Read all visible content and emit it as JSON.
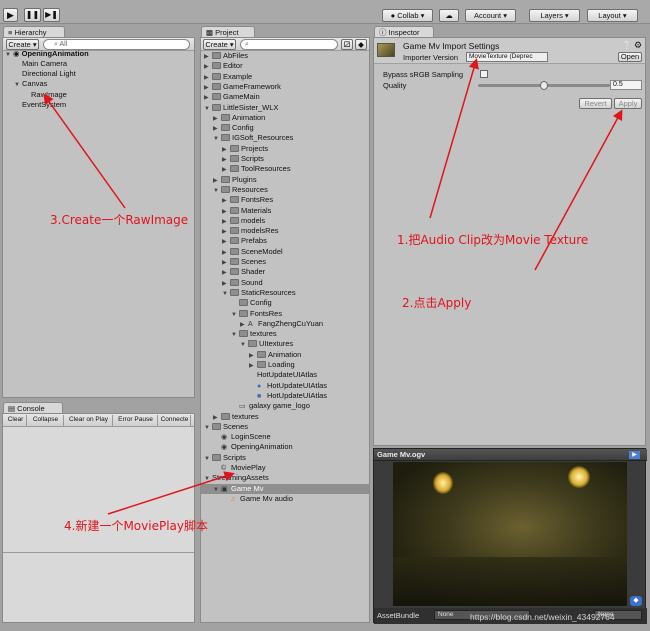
{
  "toolbar": {
    "collab": "Collab",
    "account": "Account",
    "layers": "Layers",
    "layout": "Layout"
  },
  "hierarchy": {
    "tab": "Hierarchy",
    "create": "Create",
    "search_placeholder": "All",
    "scene": "OpeningAnimation",
    "items": [
      "Main Camera",
      "Directional Light",
      "Canvas",
      "RawImage",
      "EventSystem"
    ]
  },
  "project": {
    "tab": "Project",
    "create": "Create",
    "tree": [
      {
        "label": "AbFiles",
        "depth": 0,
        "arrow": "right"
      },
      {
        "label": "Editor",
        "depth": 0,
        "arrow": "right"
      },
      {
        "label": "Example",
        "depth": 0,
        "arrow": "right"
      },
      {
        "label": "GameFramework",
        "depth": 0,
        "arrow": "right"
      },
      {
        "label": "GameMain",
        "depth": 0,
        "arrow": "right"
      },
      {
        "label": "LittleSister_WLX",
        "depth": 0,
        "arrow": "down"
      },
      {
        "label": "Animation",
        "depth": 1,
        "arrow": "right"
      },
      {
        "label": "Config",
        "depth": 1,
        "arrow": "right"
      },
      {
        "label": "IGSoft_Resources",
        "depth": 1,
        "arrow": "down"
      },
      {
        "label": "Projects",
        "depth": 2,
        "arrow": "right"
      },
      {
        "label": "Scripts",
        "depth": 2,
        "arrow": "right"
      },
      {
        "label": "ToolResources",
        "depth": 2,
        "arrow": "right"
      },
      {
        "label": "Plugins",
        "depth": 1,
        "arrow": "right"
      },
      {
        "label": "Resources",
        "depth": 1,
        "arrow": "down"
      },
      {
        "label": "FontsRes",
        "depth": 2,
        "arrow": "right"
      },
      {
        "label": "Materials",
        "depth": 2,
        "arrow": "right"
      },
      {
        "label": "models",
        "depth": 2,
        "arrow": "right"
      },
      {
        "label": "modelsRes",
        "depth": 2,
        "arrow": "right"
      },
      {
        "label": "Prefabs",
        "depth": 2,
        "arrow": "right"
      },
      {
        "label": "SceneModel",
        "depth": 2,
        "arrow": "right"
      },
      {
        "label": "Scenes",
        "depth": 2,
        "arrow": "right"
      },
      {
        "label": "Shader",
        "depth": 2,
        "arrow": "right"
      },
      {
        "label": "Sound",
        "depth": 2,
        "arrow": "right"
      },
      {
        "label": "StaticResources",
        "depth": 2,
        "arrow": "down"
      },
      {
        "label": "Config",
        "depth": 3,
        "arrow": ""
      },
      {
        "label": "FontsRes",
        "depth": 3,
        "arrow": "down"
      },
      {
        "label": "FangZhengCuYuan",
        "depth": 4,
        "arrow": "right",
        "icon": "font"
      },
      {
        "label": "textures",
        "depth": 3,
        "arrow": "down"
      },
      {
        "label": "UItextures",
        "depth": 4,
        "arrow": "down"
      },
      {
        "label": "Animation",
        "depth": 5,
        "arrow": "right"
      },
      {
        "label": "Loading",
        "depth": 5,
        "arrow": "right"
      },
      {
        "label": "HotUpdateUIAtlas",
        "depth": 5,
        "arrow": "",
        "icon": "none"
      },
      {
        "label": "HotUpdateUIAtlas",
        "depth": 5,
        "arrow": "",
        "icon": "sphere"
      },
      {
        "label": "HotUpdateUIAtlas",
        "depth": 5,
        "arrow": "",
        "icon": "cube"
      },
      {
        "label": "galaxy game_logo",
        "depth": 3,
        "arrow": "",
        "icon": "image"
      },
      {
        "label": "textures",
        "depth": 1,
        "arrow": "right"
      },
      {
        "label": "Scenes",
        "depth": 0,
        "arrow": "down"
      },
      {
        "label": "LoginScene",
        "depth": 1,
        "arrow": "",
        "icon": "unity"
      },
      {
        "label": "OpeningAnimation",
        "depth": 1,
        "arrow": "",
        "icon": "unity"
      },
      {
        "label": "Scripts",
        "depth": 0,
        "arrow": "down"
      },
      {
        "label": "MoviePlay",
        "depth": 1,
        "arrow": "",
        "icon": "script"
      },
      {
        "label": "StreamingAssets",
        "depth": 0,
        "arrow": "down",
        "icon": "none"
      },
      {
        "label": "Game Mv",
        "depth": 1,
        "arrow": "down",
        "icon": "movie",
        "selected": true
      },
      {
        "label": "Game Mv audio",
        "depth": 2,
        "arrow": "",
        "icon": "audio"
      }
    ]
  },
  "inspector": {
    "tab": "Inspector",
    "title": "Game Mv Import Settings",
    "open": "Open",
    "importer_label": "Importer Version",
    "importer_value": "MovieTexture (Deprec",
    "bypass_label": "Bypass sRGB Sampling",
    "quality_label": "Quality",
    "quality_value": "0.5",
    "quality_fraction": 0.5,
    "revert": "Revert",
    "apply": "Apply"
  },
  "console": {
    "tab": "Console",
    "buttons": [
      "Clear",
      "Collapse",
      "Clear on Play",
      "Error Pause",
      "Connecte"
    ]
  },
  "preview": {
    "title": "Game Mv.ogv",
    "assetbundle_label": "AssetBundle",
    "assetbundle_value": "None",
    "variant_value": "None",
    "watermark": "https://blog.csdn.net/weixin_43492764"
  },
  "annotations": {
    "a1": "1.把Audio Clip改为Movie Texture",
    "a2": "2.点击Apply",
    "a3": "3.Create一个RawImage",
    "a4": "4.新建一个MoviePlay脚本",
    "color": "#e0141c"
  }
}
